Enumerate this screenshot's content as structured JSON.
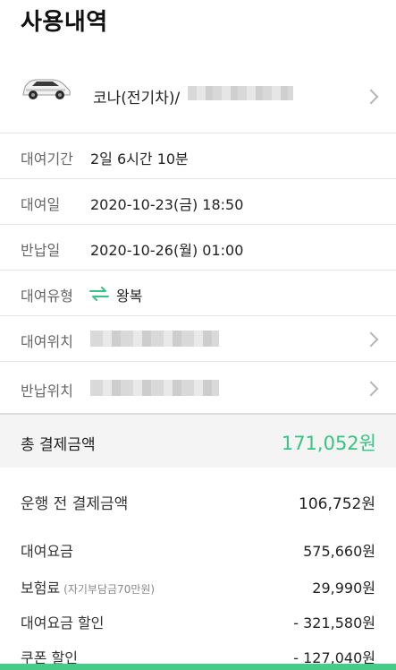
{
  "header": {
    "title": "사용내역"
  },
  "car": {
    "name": "코나(전기차)/"
  },
  "details": [
    {
      "label": "대여기간",
      "value": "2일 6시간 10분"
    },
    {
      "label": "대여일",
      "value": "2020-10-23(금) 18:50"
    },
    {
      "label": "반납일",
      "value": "2020-10-26(월) 01:00"
    },
    {
      "label": "대여유형",
      "value": "왕복"
    },
    {
      "label": "대여위치"
    },
    {
      "label": "반납위치"
    }
  ],
  "total": {
    "label": "총 결제금액",
    "amount": "171,052원"
  },
  "pre_payment": {
    "label": "운행 전 결제금액",
    "amount": "106,752원"
  },
  "charges": [
    {
      "label": "대여요금",
      "amount": "575,660원"
    },
    {
      "label": "보험료",
      "note": "(자기부담금70만원)",
      "amount": "29,990원"
    },
    {
      "label": "대여요금 할인",
      "amount": "- 321,580원"
    },
    {
      "label": "쿠폰 할인",
      "amount": "- 127,040원"
    }
  ],
  "colors": {
    "accent": "#35c481",
    "bottom_bar": "#44cc88"
  }
}
